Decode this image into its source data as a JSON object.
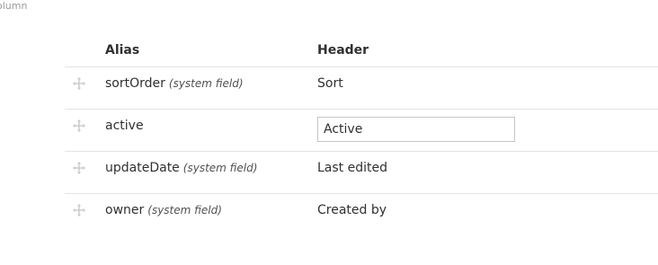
{
  "top_label": "olumn",
  "columns": {
    "alias": "Alias",
    "header": "Header"
  },
  "rows": [
    {
      "alias": "sortOrder",
      "system_note": "(system field)",
      "header": "Sort"
    },
    {
      "alias": "active",
      "system_note": "",
      "header": "Active"
    },
    {
      "alias": "updateDate",
      "system_note": "(system field)",
      "header": "Last edited"
    },
    {
      "alias": "owner",
      "system_note": "(system field)",
      "header": "Created by"
    }
  ],
  "icons": {
    "drag_handle": "move-icon"
  }
}
